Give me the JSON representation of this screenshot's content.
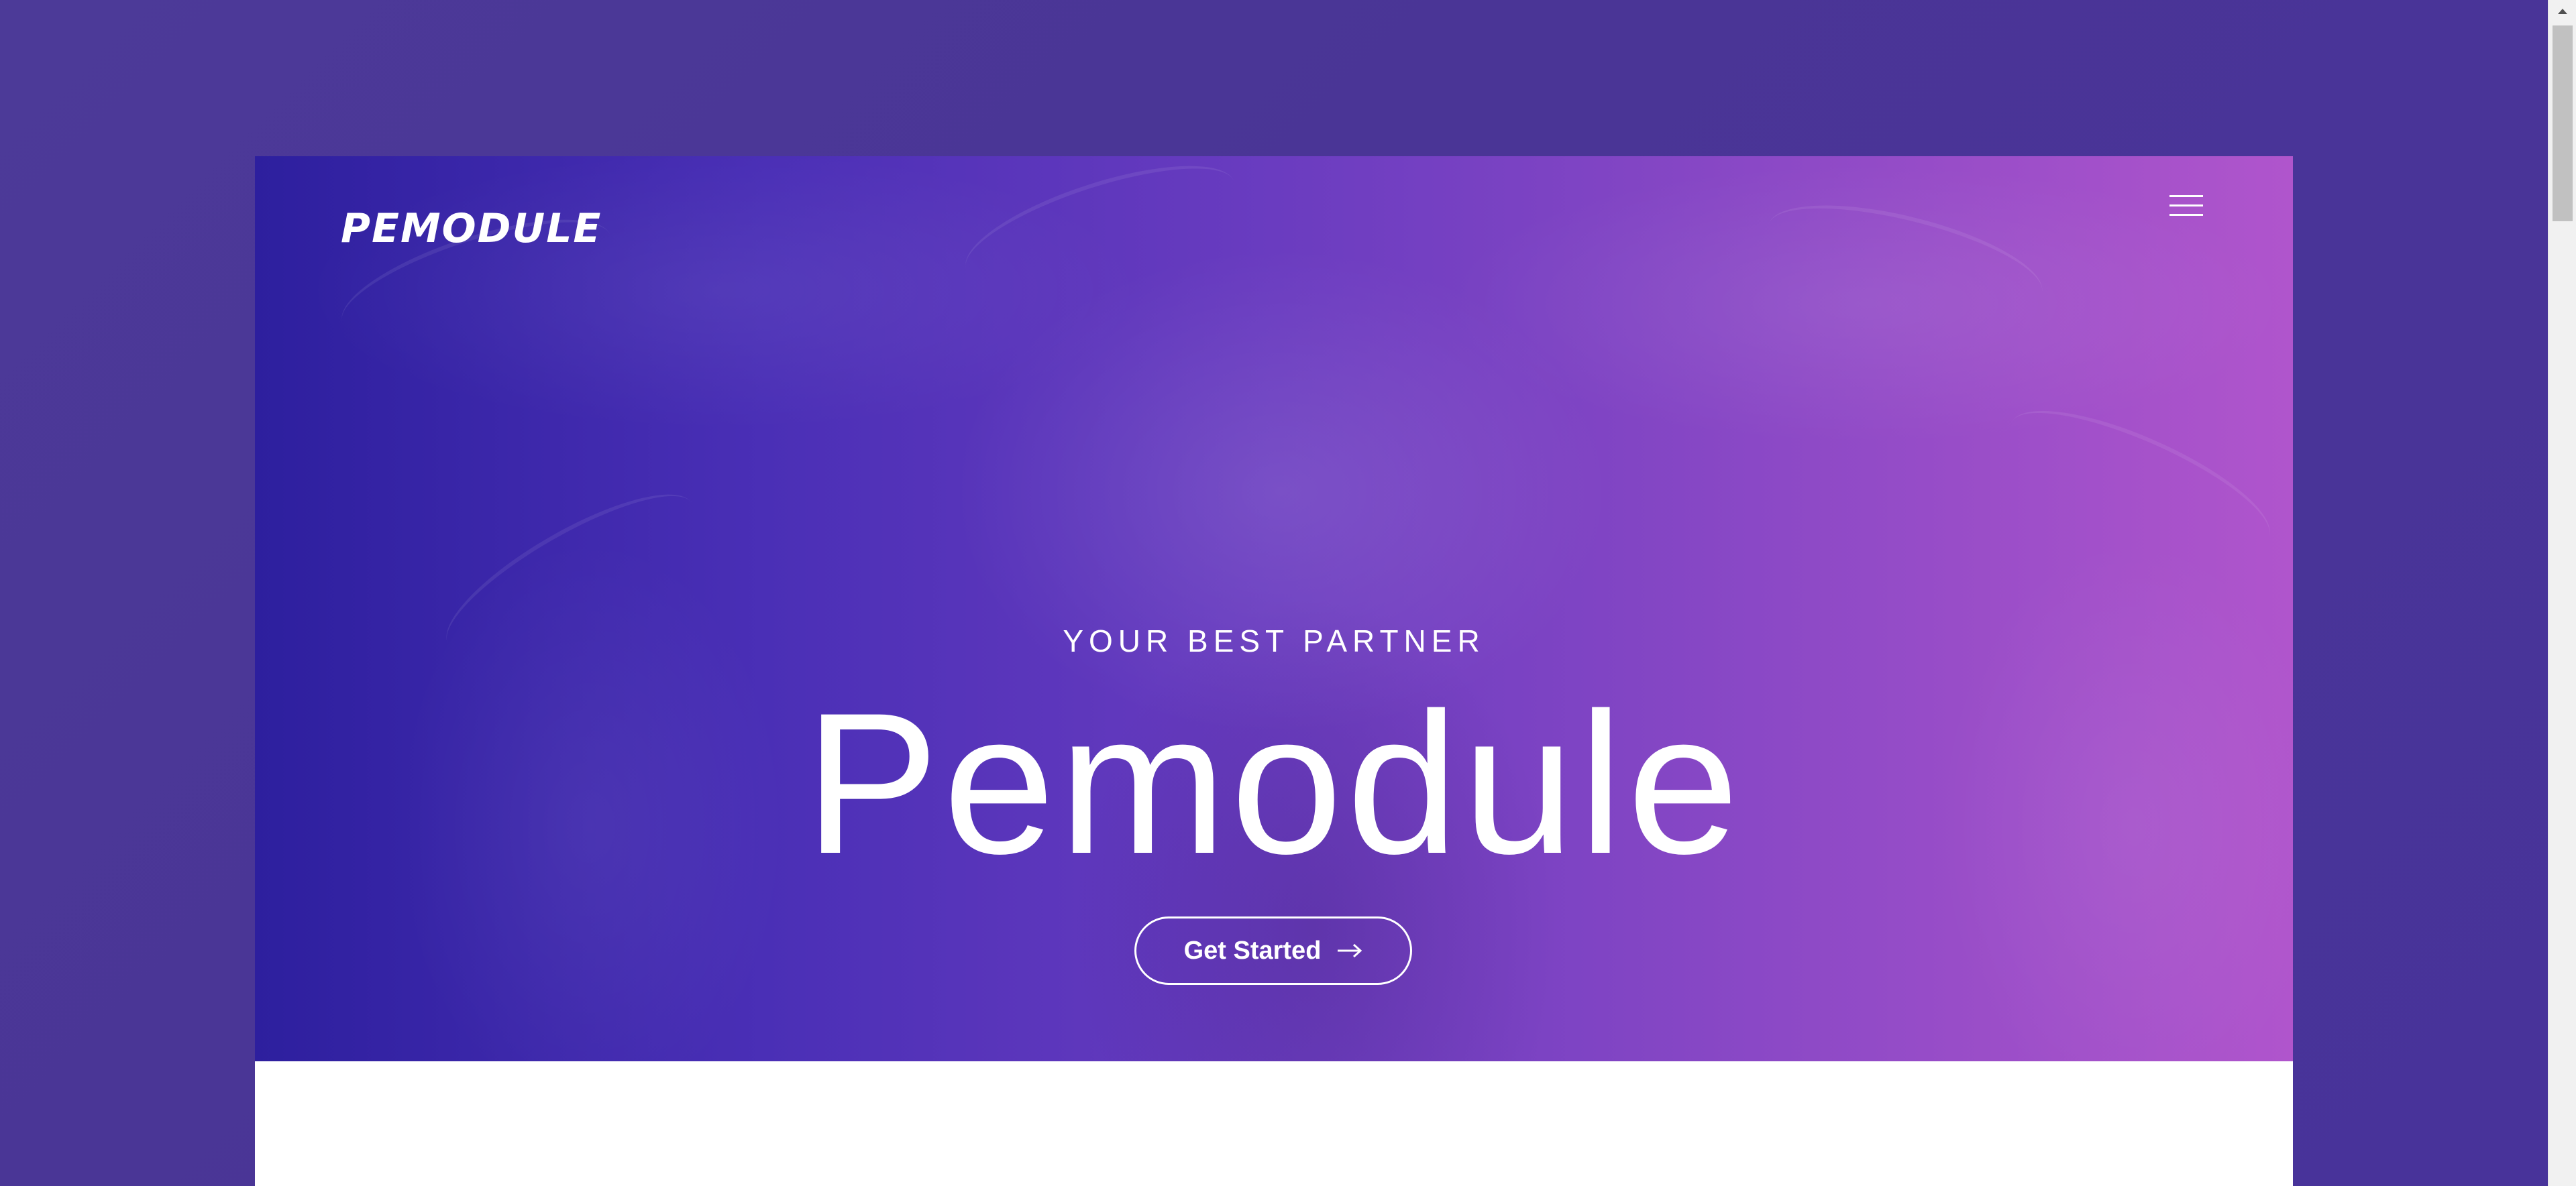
{
  "brand": {
    "logo_text": "PEMODULE"
  },
  "hero": {
    "eyebrow": "YOUR BEST PARTNER",
    "headline": "Pemodule",
    "cta_label": "Get Started",
    "cta_icon": "arrow-right-icon"
  },
  "nav": {
    "menu_icon": "hamburger-menu-icon"
  },
  "colors": {
    "page_background": "#4a3496",
    "hero_gradient_start": "#2d1f9e",
    "hero_gradient_end": "#b055cc",
    "text": "#ffffff",
    "section_background": "#ffffff"
  }
}
